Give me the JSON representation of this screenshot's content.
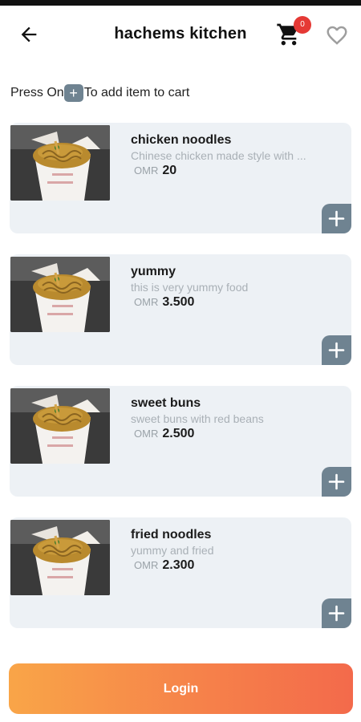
{
  "header": {
    "title": "hachems kitchen",
    "cart_count": "0",
    "back_icon": "arrow-left-icon",
    "cart_icon": "cart-icon",
    "favorite_icon": "heart-outline-icon"
  },
  "hint": {
    "before": "Press On",
    "plus": "+",
    "after": "To add item to cart"
  },
  "items": [
    {
      "name": "chicken noodles",
      "description": "Chinese chicken  made style with ...",
      "currency": "OMR",
      "price": "20"
    },
    {
      "name": "yummy",
      "description": "this is very yummy food",
      "currency": "OMR",
      "price": "3.500"
    },
    {
      "name": "sweet buns",
      "description": "sweet buns with red beans",
      "currency": "OMR",
      "price": "2.500"
    },
    {
      "name": "fried noodles",
      "description": "yummy and fried",
      "currency": "OMR",
      "price": "2.300"
    }
  ],
  "login": {
    "label": "Login"
  },
  "colors": {
    "accent_gradient_start": "#f9a548",
    "accent_gradient_end": "#f36a4b",
    "add_button": "#6f8391",
    "card_background": "#edf1f5",
    "badge": "#e53935"
  }
}
